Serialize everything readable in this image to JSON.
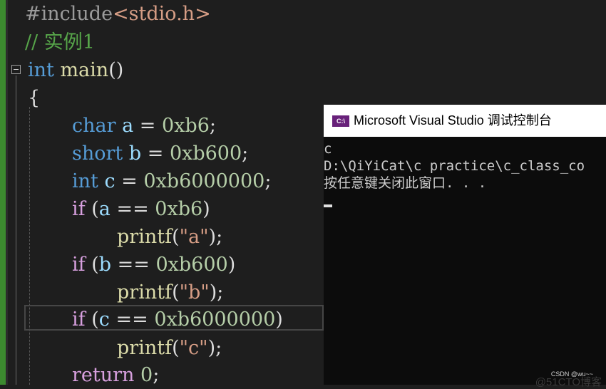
{
  "editor": {
    "lines": [
      {
        "id": "include",
        "segments": [
          {
            "t": "#include",
            "c": "pp"
          },
          {
            "t": "<stdio.h>",
            "c": "str"
          }
        ]
      },
      {
        "id": "comment",
        "segments": [
          {
            "t": "// 实例1",
            "c": "cm"
          }
        ]
      },
      {
        "id": "main-decl",
        "segments": [
          {
            "t": "int",
            "c": "kw"
          },
          {
            "t": " main",
            "c": "fn"
          },
          {
            "t": "()",
            "c": ""
          }
        ]
      },
      {
        "id": "open-brace",
        "segments": [
          {
            "t": "{",
            "c": ""
          }
        ]
      },
      {
        "id": "decl-a",
        "segments": [
          {
            "t": "char",
            "c": "kw"
          },
          {
            "t": " a",
            "c": "var"
          },
          {
            "t": " = ",
            "c": ""
          },
          {
            "t": "0xb6",
            "c": "num"
          },
          {
            "t": ";",
            "c": ""
          }
        ]
      },
      {
        "id": "decl-b",
        "segments": [
          {
            "t": "short",
            "c": "kw"
          },
          {
            "t": " b",
            "c": "var"
          },
          {
            "t": " = ",
            "c": ""
          },
          {
            "t": "0xb600",
            "c": "num"
          },
          {
            "t": ";",
            "c": ""
          }
        ]
      },
      {
        "id": "decl-c",
        "segments": [
          {
            "t": "int",
            "c": "kw"
          },
          {
            "t": " c",
            "c": "var"
          },
          {
            "t": " = ",
            "c": ""
          },
          {
            "t": "0xb6000000",
            "c": "num"
          },
          {
            "t": ";",
            "c": ""
          }
        ]
      },
      {
        "id": "if-a",
        "segments": [
          {
            "t": "if",
            "c": "ctl"
          },
          {
            "t": " (",
            "c": ""
          },
          {
            "t": "a",
            "c": "var"
          },
          {
            "t": " == ",
            "c": ""
          },
          {
            "t": "0xb6",
            "c": "num"
          },
          {
            "t": ")",
            "c": ""
          }
        ]
      },
      {
        "id": "printf-a",
        "segments": [
          {
            "t": "printf",
            "c": "fn"
          },
          {
            "t": "(",
            "c": ""
          },
          {
            "t": "\"a\"",
            "c": "str"
          },
          {
            "t": ");",
            "c": ""
          }
        ]
      },
      {
        "id": "if-b",
        "segments": [
          {
            "t": "if",
            "c": "ctl"
          },
          {
            "t": " (",
            "c": ""
          },
          {
            "t": "b",
            "c": "var"
          },
          {
            "t": " == ",
            "c": ""
          },
          {
            "t": "0xb600",
            "c": "num"
          },
          {
            "t": ")",
            "c": ""
          }
        ]
      },
      {
        "id": "printf-b",
        "segments": [
          {
            "t": "printf",
            "c": "fn"
          },
          {
            "t": "(",
            "c": ""
          },
          {
            "t": "\"b\"",
            "c": "str"
          },
          {
            "t": ");",
            "c": ""
          }
        ]
      },
      {
        "id": "if-c",
        "segments": [
          {
            "t": "if",
            "c": "ctl"
          },
          {
            "t": " (",
            "c": ""
          },
          {
            "t": "c",
            "c": "var"
          },
          {
            "t": " == ",
            "c": ""
          },
          {
            "t": "0xb6000000",
            "c": "num"
          },
          {
            "t": ")",
            "c": ""
          }
        ]
      },
      {
        "id": "printf-c",
        "segments": [
          {
            "t": "printf",
            "c": "fn"
          },
          {
            "t": "(",
            "c": ""
          },
          {
            "t": "\"c\"",
            "c": "str"
          },
          {
            "t": ");",
            "c": ""
          }
        ]
      },
      {
        "id": "return",
        "segments": [
          {
            "t": "return",
            "c": "ctl"
          },
          {
            "t": " 0",
            "c": "num"
          },
          {
            "t": ";",
            "c": ""
          }
        ]
      }
    ]
  },
  "console": {
    "icon_label": "C:\\",
    "title": "Microsoft Visual Studio 调试控制台",
    "output": [
      "c",
      "D:\\QiYiCat\\c practice\\c_class_co",
      "按任意键关闭此窗口. . ."
    ]
  },
  "watermark": {
    "csdn": "CSDN @wu~~",
    "site": "@51CTO博客"
  },
  "colors": {
    "background": "#1e1e1e",
    "keyword": "#569cd6",
    "control": "#d8a0df",
    "comment": "#57a64a",
    "string": "#d69d85",
    "number": "#b5cea8"
  }
}
